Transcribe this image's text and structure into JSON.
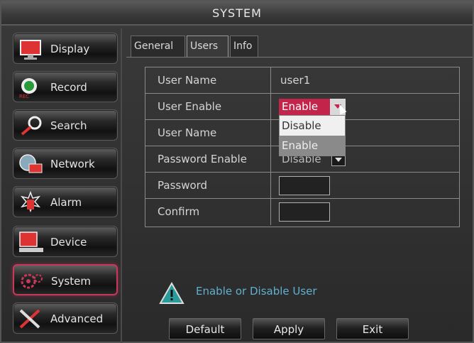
{
  "title": "SYSTEM",
  "sidebar": {
    "items": [
      {
        "label": "Display",
        "icon": "monitor-icon"
      },
      {
        "label": "Record",
        "icon": "record-icon"
      },
      {
        "label": "Search",
        "icon": "search-icon"
      },
      {
        "label": "Network",
        "icon": "network-icon"
      },
      {
        "label": "Alarm",
        "icon": "alarm-icon"
      },
      {
        "label": "Device",
        "icon": "device-icon"
      },
      {
        "label": "System",
        "icon": "gear-icon",
        "active": true
      },
      {
        "label": "Advanced",
        "icon": "tools-icon"
      }
    ]
  },
  "tabs": [
    {
      "label": "General"
    },
    {
      "label": "Users",
      "active": true
    },
    {
      "label": "Info"
    }
  ],
  "form": {
    "user_name_label": "User Name",
    "user_name_value": "user1",
    "user_enable_label": "User Enable",
    "user_enable_value": "Enable",
    "user_name2_label": "User Name",
    "password_enable_label": "Password Enable",
    "password_enable_value": "Disable",
    "password_label": "Password",
    "confirm_label": "Confirm"
  },
  "dropdown": {
    "options": [
      "Disable",
      "Enable"
    ],
    "selected": "Enable"
  },
  "hint": {
    "text": "Enable or Disable User"
  },
  "buttons": {
    "default": "Default",
    "apply": "Apply",
    "exit": "Exit"
  },
  "colors": {
    "accent": "#c2244a",
    "hint": "#5fb0d0"
  }
}
